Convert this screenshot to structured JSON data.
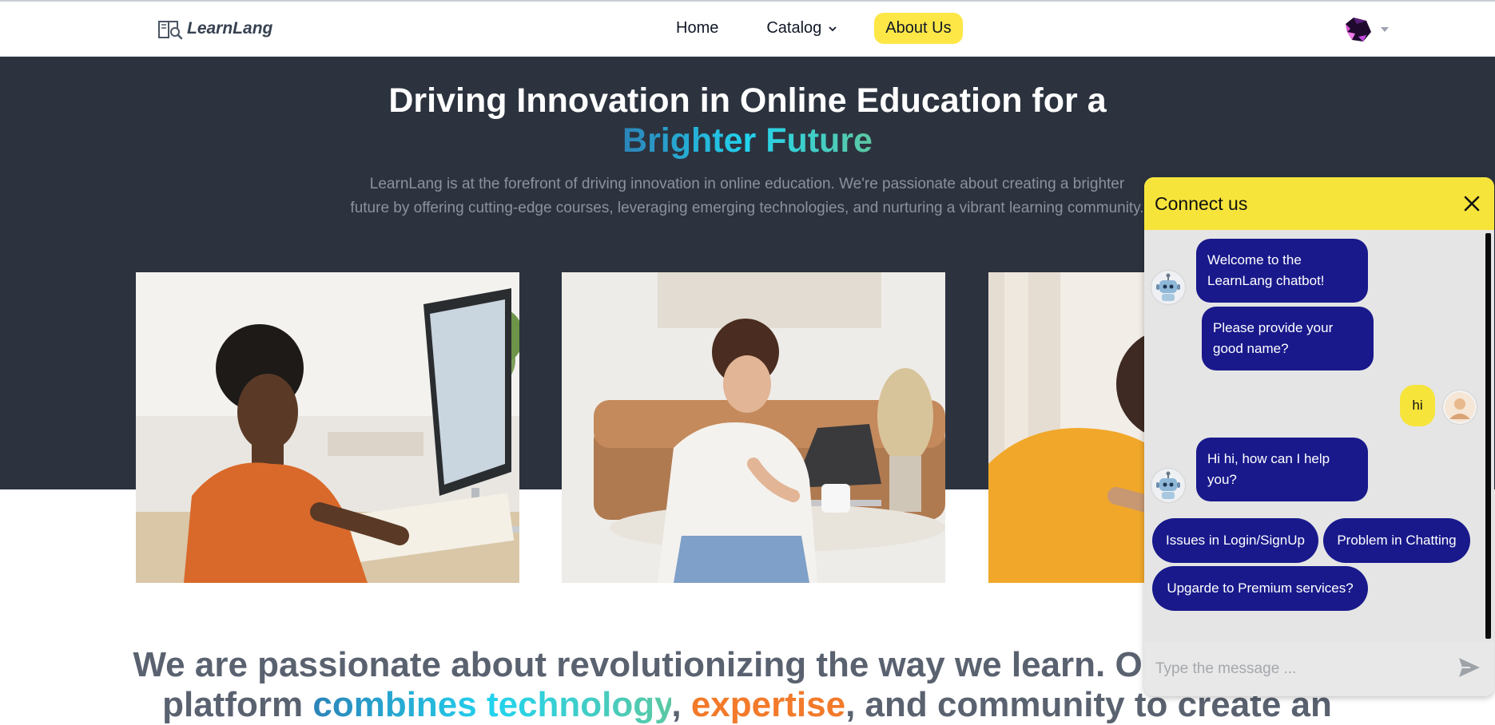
{
  "nav": {
    "brand": "LearnLang",
    "items": [
      {
        "label": "Home"
      },
      {
        "label": "Catalog"
      },
      {
        "label": "About Us"
      }
    ]
  },
  "hero": {
    "title_line1": "Driving Innovation in Online Education for a",
    "title_line2": "Brighter Future",
    "subtitle_line1": "LearnLang is at the forefront of driving innovation in online education. We're passionate about creating a brighter",
    "subtitle_line2": "future by offering cutting-edge courses, leveraging emerging technologies, and nurturing a vibrant learning community."
  },
  "mission": {
    "line1": "We are passionate about revolutionizing the way we learn. Our innovative",
    "line2_start": "platform ",
    "hl1": "combines technology",
    "sep1": ", ",
    "hl2": "expertise",
    "line2_end": ", and community to create an"
  },
  "chatbot": {
    "title": "Connect us",
    "messages": [
      {
        "from": "bot",
        "text": "Welcome to the LearnLang chatbot!"
      },
      {
        "from": "bot",
        "text": "Please provide your good name?"
      },
      {
        "from": "user",
        "text": "hi"
      },
      {
        "from": "bot",
        "text": "Hi hi, how can I help you?"
      }
    ],
    "options": [
      "Issues in Login/SignUp",
      "Problem in Chatting",
      "Upgarde to Premium services?"
    ],
    "input_placeholder": "Type the message ..."
  },
  "colors": {
    "hero_bg": "#2c333f",
    "nav_active": "#fde747",
    "chat_header": "#f7e43b",
    "bot_bubble": "#19198c",
    "accent_orange": "#f27a2a"
  }
}
